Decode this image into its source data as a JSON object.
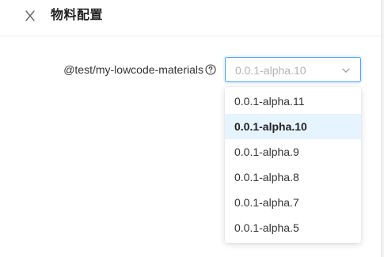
{
  "header": {
    "title": "物料配置",
    "close_icon": "close-icon"
  },
  "form": {
    "field_label": "@test/my-lowcode-materials",
    "help_icon": "question-circle-icon",
    "select": {
      "value": "0.0.1-alpha.10",
      "arrow_icon": "chevron-down-icon"
    }
  },
  "dropdown": {
    "selected": "0.0.1-alpha.10",
    "options": [
      {
        "label": "0.0.1-alpha.11"
      },
      {
        "label": "0.0.1-alpha.10"
      },
      {
        "label": "0.0.1-alpha.9"
      },
      {
        "label": "0.0.1-alpha.8"
      },
      {
        "label": "0.0.1-alpha.7"
      },
      {
        "label": "0.0.1-alpha.5"
      }
    ]
  },
  "colors": {
    "accent": "#4a9ff5",
    "selected_bg": "#e6f4ff",
    "placeholder_text": "#b3b3b3"
  }
}
